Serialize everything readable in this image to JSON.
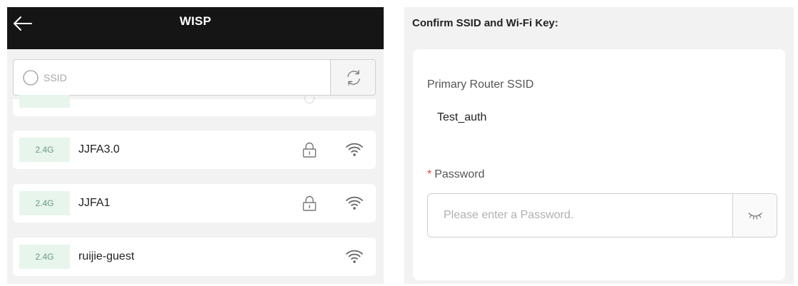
{
  "wisp": {
    "title": "WISP",
    "search": {
      "placeholder": "SSID",
      "value": ""
    },
    "networks": [
      {
        "band": "",
        "ssid": "",
        "locked": true
      },
      {
        "band": "2.4G",
        "ssid": "JJFA3.0",
        "locked": true
      },
      {
        "band": "2.4G",
        "ssid": "JJFA1",
        "locked": true
      },
      {
        "band": "2.4G",
        "ssid": "ruijie-guest",
        "locked": false
      }
    ]
  },
  "confirm": {
    "title": "Confirm SSID and Wi-Fi Key:",
    "primary_ssid_label": "Primary Router SSID",
    "primary_ssid_value": "Test_auth",
    "password_required_mark": "*",
    "password_label": "Password",
    "password_placeholder": "Please enter a Password.",
    "password_value": ""
  },
  "icons": {
    "back": "arrow-left-icon",
    "search": "search-icon",
    "refresh": "refresh-icon",
    "lock": "lock-icon",
    "wifi": "wifi-signal-icon",
    "visibility": "eye-closed-icon"
  },
  "colors": {
    "header_bg": "#151515",
    "panel_bg": "#f2f2f2",
    "band_badge_bg": "#e7f5ec",
    "band_badge_text": "#6a9c82",
    "required_mark": "#e2453c"
  }
}
